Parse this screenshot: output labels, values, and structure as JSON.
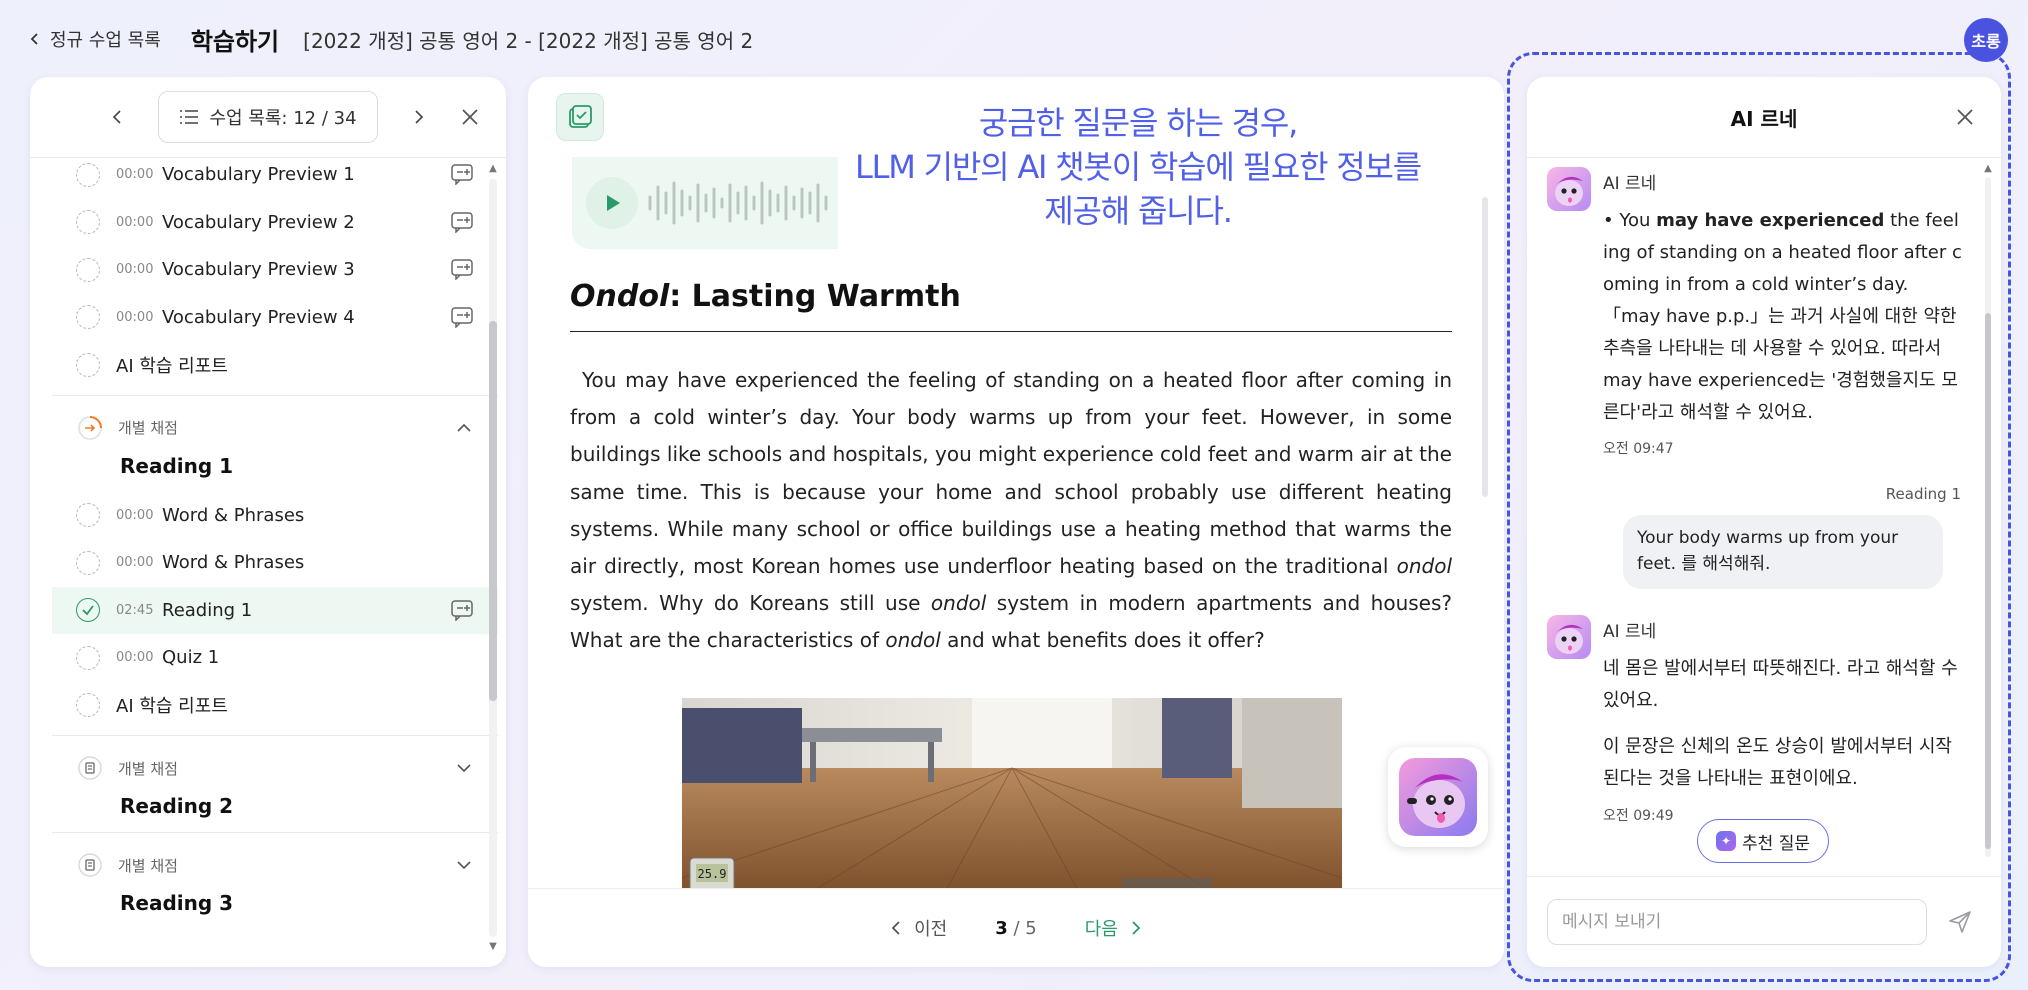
{
  "header": {
    "back_label": "정규 수업 목록",
    "title": "학습하기",
    "course": "[2022 개정] 공통 영어 2 - [2022 개정] 공통 영어 2"
  },
  "lesson_nav": {
    "label": "수업 목록: 12 / 34"
  },
  "lesson_list": {
    "items_top": [
      {
        "time": "00:00",
        "label": "Vocabulary Preview 1",
        "chat": true
      },
      {
        "time": "00:00",
        "label": "Vocabulary Preview 2",
        "chat": true
      },
      {
        "time": "00:00",
        "label": "Vocabulary Preview 3",
        "chat": true
      },
      {
        "time": "00:00",
        "label": "Vocabulary Preview 4",
        "chat": true
      },
      {
        "time": "",
        "label": "AI 학습 리포트",
        "chat": false
      }
    ],
    "group1": {
      "subtitle": "개별 채점",
      "title": "Reading 1"
    },
    "items_g1": [
      {
        "time": "00:00",
        "label": "Word & Phrases",
        "chat": false
      },
      {
        "time": "00:00",
        "label": "Word & Phrases",
        "chat": false
      },
      {
        "time": "02:45",
        "label": "Reading 1",
        "chat": true,
        "done": true
      },
      {
        "time": "00:00",
        "label": "Quiz 1",
        "chat": false
      },
      {
        "time": "",
        "label": "AI 학습 리포트",
        "chat": false
      }
    ],
    "group2": {
      "subtitle": "개별 채점",
      "title": "Reading 2"
    },
    "group3": {
      "subtitle": "개별 채점",
      "title": "Reading 3"
    }
  },
  "callout": {
    "line1": "궁금한 질문을 하는 경우,",
    "line2": "LLM 기반의 AI 챗봇이 학습에 필요한 정보를",
    "line3": "제공해 줍니다."
  },
  "article": {
    "title_italic": "Ondol",
    "title_rest": ": Lasting Warmth",
    "p1": "You may have experienced the feeling of standing on a heated floor after coming in from a cold winter’s day. Your body warms up from your feet. However, in some buildings like schools and hospitals, you might experience cold feet and warm air at the same time. This is because your home and school probably use different heating systems. While many school or office buildings use a heating method that warms the air directly, most Korean homes use underfloor heating based on the traditional ",
    "w1": "ondol",
    "p2": " system. Why do Koreans still use ",
    "w2": "ondol",
    "p3": " system in modern apartments and houses? What are the characteristics of ",
    "w3": "ondol",
    "p4": " and what benefits does it offer?"
  },
  "photo": {
    "thermo": "25.9"
  },
  "pager": {
    "prev": "이전",
    "current": "3",
    "total": "/ 5",
    "next": "다음"
  },
  "chat": {
    "title": "AI 르네",
    "bot_name": "AI 르네",
    "m1_pre": "• You ",
    "m1_bold": "may have experienced",
    "m1_post": " the feeling of standing on a heated floor after coming in from a cold winter’s day.",
    "m1_kr": "「may have p.p.」는 과거 사실에 대한 약한 추측을 나타내는 데 사용할 수 있어요. 따라서 may have experienced는 '경험했을지도 모른다'라고 해석할 수 있어요.",
    "m1_time": "오전 09:47",
    "ctx": "Reading 1",
    "user_msg": "Your body warms up from your feet. 를 해석해줘.",
    "m2_a": "네 몸은 발에서부터 따뜻해진다. 라고 해석할 수 있어요.",
    "m2_b": "이 문장은 신체의 온도 상승이 발에서부터 시작된다는 것을 나타내는 표현이에요.",
    "m2_time": "오전 09:49",
    "suggest": "추천 질문",
    "input_placeholder": "메시지 보내기"
  },
  "badge": "초롱",
  "colors": {
    "accent": "#4a52e0",
    "green": "#2a9a6a",
    "callout": "#5160e8"
  }
}
